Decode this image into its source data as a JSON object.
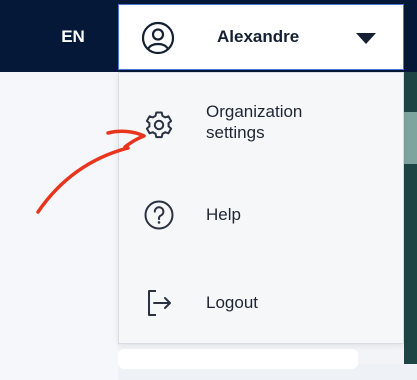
{
  "header": {
    "language": "EN",
    "user": {
      "name": "Alexandre",
      "avatar_icon": "user-circle-icon",
      "caret_icon": "caret-down-icon"
    }
  },
  "menu": {
    "items": [
      {
        "label": "Organization settings",
        "icon": "gear-icon"
      },
      {
        "label": "Help",
        "icon": "question-circle-icon"
      },
      {
        "label": "Logout",
        "icon": "logout-icon"
      }
    ]
  },
  "colors": {
    "topbar": "#051838",
    "menu_bg": "#f6f7f9",
    "focus_border": "#4a7bd0",
    "annotation": "#e8361e",
    "accent_strip": "#1d4545"
  }
}
